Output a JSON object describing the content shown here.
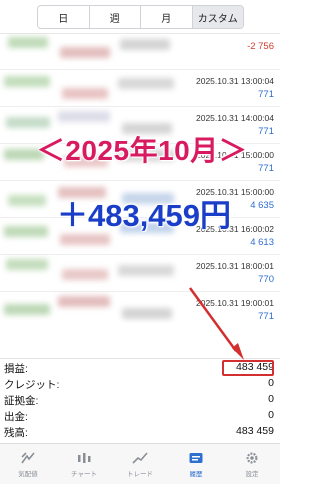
{
  "period_tabs": [
    {
      "label": "日"
    },
    {
      "label": "週"
    },
    {
      "label": "月"
    },
    {
      "label": "カスタム"
    }
  ],
  "deals": [
    {
      "date": "",
      "value": "-2 756"
    },
    {
      "date": "2025.10.31 13:00:04",
      "value": "771"
    },
    {
      "date": "2025.10.31 14:00:04",
      "value": "771"
    },
    {
      "date": "2025.10.31 15:00:00",
      "value": "771"
    },
    {
      "date": "2025.10.31 15:00:00",
      "value": "4 635"
    },
    {
      "date": "2025.10.31 16:00:02",
      "value": "4 613"
    },
    {
      "date": "2025.10.31 18:00:01",
      "value": "770"
    },
    {
      "date": "2025.10.31 19:00:01",
      "value": "771"
    }
  ],
  "overlay": {
    "month": "＜2025年10月＞",
    "amount": "＋483,459円"
  },
  "summary": [
    {
      "label": "損益:",
      "value": "483 459"
    },
    {
      "label": "クレジット:",
      "value": "0"
    },
    {
      "label": "証拠金:",
      "value": "0"
    },
    {
      "label": "出金:",
      "value": "0"
    },
    {
      "label": "残高:",
      "value": "483 459"
    }
  ],
  "bottom_nav": [
    {
      "label": "気配値",
      "icon": "quotes-icon"
    },
    {
      "label": "チャート",
      "icon": "chart-icon"
    },
    {
      "label": "トレード",
      "icon": "trade-icon"
    },
    {
      "label": "履歴",
      "icon": "history-icon"
    },
    {
      "label": "設定",
      "icon": "gear-icon"
    }
  ],
  "colors": {
    "profit_blue": "#2f6fd0",
    "loss_red": "#d33a2c",
    "overlay_pink": "#d81b60",
    "overlay_blue": "#1a3ec8",
    "highlight_red": "#d32f2f"
  }
}
